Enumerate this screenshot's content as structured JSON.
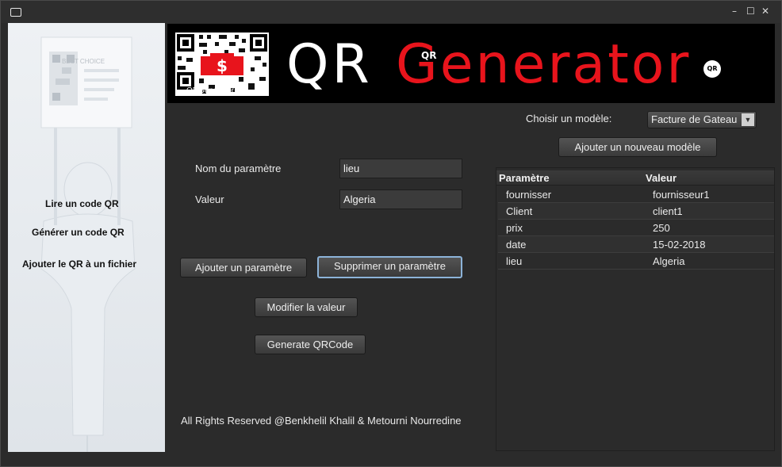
{
  "window": {
    "controls": {
      "minimize": "–",
      "maximize": "☐",
      "close": "✕"
    }
  },
  "banner": {
    "logo_caption": "QRGenerator",
    "brand_qr": "QR",
    "brand_small": "QR",
    "brand_generator": "Generator",
    "brand_badge": "QR"
  },
  "sidebar": {
    "items": [
      {
        "label": "Lire un code QR"
      },
      {
        "label": "Générer un code QR"
      },
      {
        "label": "Ajouter le QR à un fichier"
      }
    ],
    "poster_text": "BEST CHOICE"
  },
  "form": {
    "param_name_label": "Nom du paramètre",
    "param_name_value": "lieu",
    "value_label": "Valeur",
    "value_value": "Algeria"
  },
  "buttons": {
    "add_param": "Ajouter un paramètre",
    "remove_param": "Supprimer un paramètre",
    "modify_value": "Modifier la valeur",
    "generate": "Generate QRCode",
    "add_model": "Ajouter un nouveau modèle"
  },
  "model": {
    "label": "Choisir un modèle:",
    "selected": "Facture de Gateau"
  },
  "table": {
    "headers": [
      "Paramètre",
      "Valeur"
    ],
    "rows": [
      [
        "fournisser",
        "fournisseur1"
      ],
      [
        "Client",
        "client1"
      ],
      [
        "prix",
        "250"
      ],
      [
        "date",
        "15-02-2018"
      ],
      [
        "lieu",
        "Algeria"
      ]
    ]
  },
  "footer": "All Rights Reserved @Benkhelil Khalil & Metourni Nourredine",
  "colors": {
    "accent_red": "#e8141c",
    "background": "#2b2b2b",
    "banner": "#000000"
  }
}
